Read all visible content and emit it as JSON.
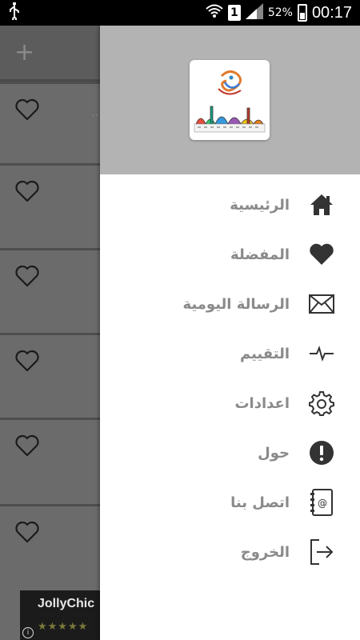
{
  "status_bar": {
    "usb_icon": "usb-icon",
    "wifi_icon": "wifi-icon",
    "sim_badge": "1",
    "signal_icon": "signal-icon",
    "battery_percent": "52%",
    "battery_icon": "battery-icon",
    "time": "00:17"
  },
  "underlay": {
    "add_icon": "plus-icon",
    "card_stray_text": "..",
    "ad": {
      "title": "JollyChic",
      "stars": "★★★★★",
      "info_icon": "i"
    }
  },
  "drawer": {
    "header_color": "#b3b3b3",
    "logo_icon": "ramadan-logo-icon",
    "items": [
      {
        "label": "الرئيسية",
        "icon": "home-icon"
      },
      {
        "label": "المفضلة",
        "icon": "heart-icon"
      },
      {
        "label": "الرسالة اليومية",
        "icon": "envelope-icon"
      },
      {
        "label": "التقييم",
        "icon": "pulse-icon"
      },
      {
        "label": "اعدادات",
        "icon": "gear-icon"
      },
      {
        "label": "حول",
        "icon": "info-alert-icon"
      },
      {
        "label": "اتصل بنا",
        "icon": "contact-book-icon"
      },
      {
        "label": "الخروج",
        "icon": "exit-icon"
      }
    ]
  }
}
